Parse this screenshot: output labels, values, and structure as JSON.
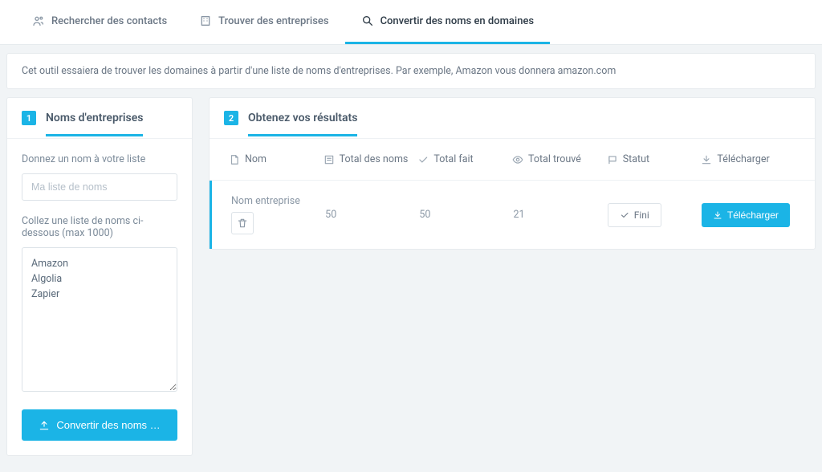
{
  "tabs": {
    "contacts": "Rechercher des contacts",
    "companies": "Trouver des entreprises",
    "convert": "Convertir des noms en domaines"
  },
  "info": "Cet outil essaiera de trouver les domaines à partir d'une liste de noms d'entreprises. Par exemple, Amazon vous donnera amazon.com",
  "step1": {
    "num": "1",
    "title": "Noms d'entreprises",
    "list_name_label": "Donnez un nom à votre liste",
    "list_name_placeholder": "Ma liste de noms",
    "paste_label": "Collez une liste de noms ci-dessous (max 1000)",
    "textarea_value": "Amazon\nAlgolia\nZapier",
    "convert_btn": "Convertir des noms …"
  },
  "step2": {
    "num": "2",
    "title": "Obtenez vos résultats",
    "headers": {
      "name": "Nom",
      "total_names": "Total des noms",
      "total_done": "Total fait",
      "total_found": "Total trouvé",
      "status": "Statut",
      "download": "Télécharger"
    },
    "row": {
      "name": "Nom entreprise",
      "total_names": "50",
      "total_done": "50",
      "total_found": "21",
      "status": "Fini",
      "download": "Télécharger"
    }
  }
}
